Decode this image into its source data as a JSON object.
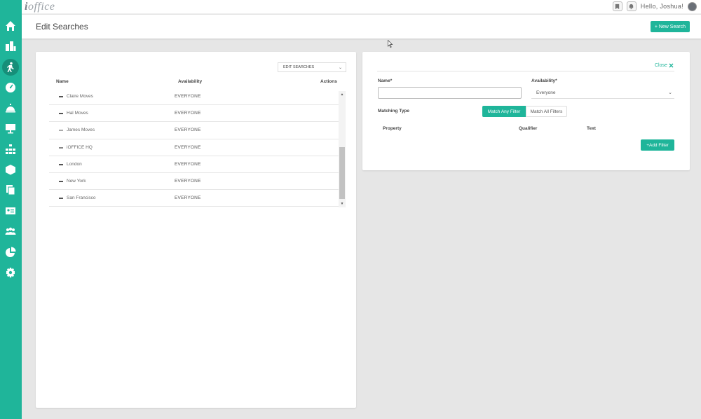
{
  "brand": {
    "logo_prefix": "i",
    "logo_text": "office",
    "accent": "#1fb59a"
  },
  "sidebar": {
    "items": [
      {
        "icon": "home-icon"
      },
      {
        "icon": "buildings-icon"
      },
      {
        "icon": "person-moving-icon",
        "active": true
      },
      {
        "icon": "dashboard-gauge-icon"
      },
      {
        "icon": "service-bell-icon"
      },
      {
        "icon": "presentation-board-icon"
      },
      {
        "icon": "org-chart-icon"
      },
      {
        "icon": "box-icon"
      },
      {
        "icon": "documents-icon"
      },
      {
        "icon": "id-card-icon"
      },
      {
        "icon": "team-icon"
      },
      {
        "icon": "pie-chart-icon"
      },
      {
        "icon": "settings-gear-icon"
      }
    ]
  },
  "topbar": {
    "greeting": "Hello, Joshua!"
  },
  "header": {
    "title": "Edit Searches",
    "new_search_label": "+ New Search"
  },
  "searches": {
    "dropdown_label": "EDIT SEARCHES",
    "columns": {
      "name": "Name",
      "availability": "Availability",
      "actions": "Actions"
    },
    "rows": [
      {
        "name": "Claire Moves",
        "availability": "EVERYONE"
      },
      {
        "name": "Hal Moves",
        "availability": "EVERYONE"
      },
      {
        "name": "James Moves",
        "availability": "EVERYONE"
      },
      {
        "name": "iOFFICE HQ",
        "availability": "EVERYONE"
      },
      {
        "name": "London",
        "availability": "EVERYONE"
      },
      {
        "name": "New York",
        "availability": "EVERYONE"
      },
      {
        "name": "San Francisco",
        "availability": "EVERYONE"
      }
    ]
  },
  "form": {
    "close_label": "Close",
    "name_label": "Name*",
    "name_value": "",
    "availability_label": "Availability*",
    "availability_value": "Everyone",
    "matching_type_label": "Matching Type",
    "match_any_label": "Match Any Filter",
    "match_all_label": "Match All Filters",
    "filter_columns": {
      "property": "Property",
      "qualifier": "Qualifier",
      "text": "Text"
    },
    "add_filter_label": "+Add Filter"
  }
}
